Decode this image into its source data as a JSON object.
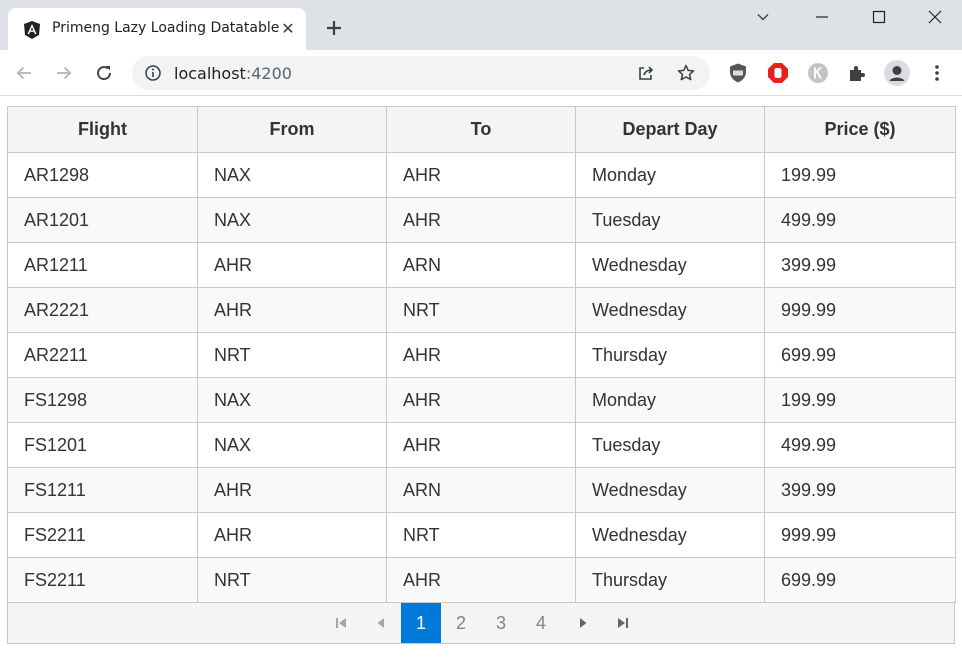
{
  "browser": {
    "tab_title": "Primeng Lazy Loading Datatable",
    "tab_close": "✕",
    "url_host": "localhost",
    "url_port": ":4200",
    "icons": {
      "favicon": "angular-logo-icon",
      "new_tab": "plus-icon",
      "tab_search": "chevron-down-icon",
      "minimize": "minimize-icon",
      "maximize": "maximize-icon",
      "close_window": "close-icon",
      "back": "arrow-left-icon",
      "forward": "arrow-right-icon",
      "reload": "reload-icon",
      "site_info": "info-icon",
      "share": "share-icon",
      "bookmark": "star-icon",
      "extensions": [
        "adblock-shield-icon",
        "stop-hand-icon",
        "k-extension-icon",
        "puzzle-icon",
        "profile-avatar-icon",
        "kebab-menu-icon"
      ]
    },
    "colors": {
      "titlebar": "#dee1e6",
      "omnibox": "#f1f3f4"
    }
  },
  "table": {
    "headers": [
      "Flight",
      "From",
      "To",
      "Depart Day",
      "Price ($)"
    ],
    "rows": [
      [
        "AR1298",
        "NAX",
        "AHR",
        "Monday",
        "199.99"
      ],
      [
        "AR1201",
        "NAX",
        "AHR",
        "Tuesday",
        "499.99"
      ],
      [
        "AR1211",
        "AHR",
        "ARN",
        "Wednesday",
        "399.99"
      ],
      [
        "AR2221",
        "AHR",
        "NRT",
        "Wednesday",
        "999.99"
      ],
      [
        "AR2211",
        "NRT",
        "AHR",
        "Thursday",
        "699.99"
      ],
      [
        "FS1298",
        "NAX",
        "AHR",
        "Monday",
        "199.99"
      ],
      [
        "FS1201",
        "NAX",
        "AHR",
        "Tuesday",
        "499.99"
      ],
      [
        "FS1211",
        "AHR",
        "ARN",
        "Wednesday",
        "399.99"
      ],
      [
        "FS2211",
        "AHR",
        "NRT",
        "Wednesday",
        "999.99"
      ],
      [
        "FS2211",
        "NRT",
        "AHR",
        "Thursday",
        "699.99"
      ]
    ],
    "colors": {
      "header_bg": "#f4f4f4",
      "border": "#c8c8c8",
      "text": "#333333"
    }
  },
  "paginator": {
    "pages": [
      "1",
      "2",
      "3",
      "4"
    ],
    "current_page": "1",
    "icons": [
      "first-page-icon",
      "prev-page-icon",
      "next-page-icon",
      "last-page-icon"
    ],
    "colors": {
      "active": "#007ad9",
      "inactive_text": "#848484"
    }
  }
}
